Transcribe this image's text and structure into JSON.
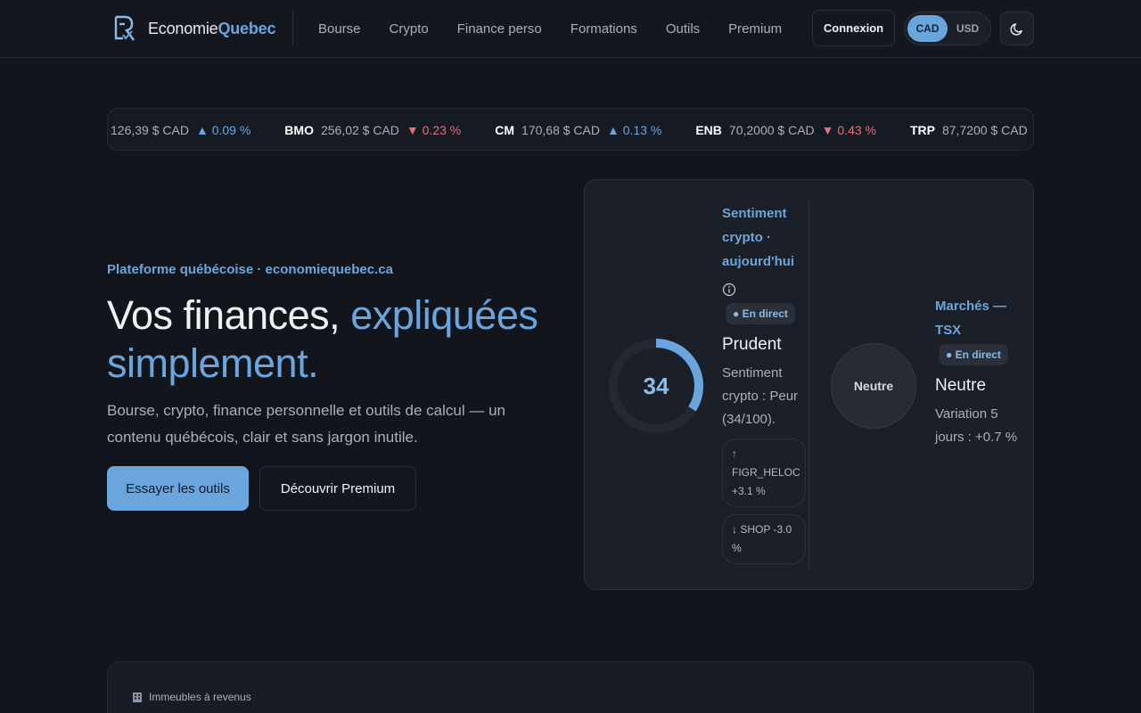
{
  "header": {
    "logo_text_plain": "Economie",
    "logo_text_accent": "Quebec",
    "nav": [
      "Bourse",
      "Crypto",
      "Finance perso",
      "Formations",
      "Outils",
      "Premium"
    ],
    "login_label": "Connexion",
    "currency_options": [
      "CAD",
      "USD"
    ],
    "currency_selected": "CAD",
    "theme_icon": "moon-icon"
  },
  "ticker": [
    {
      "symbol": "",
      "price": "126,39 $ CAD",
      "direction": "up",
      "change": "0.09 %"
    },
    {
      "symbol": "BMO",
      "price": "256,02 $ CAD",
      "direction": "down",
      "change": "0.23 %"
    },
    {
      "symbol": "CM",
      "price": "170,68 $ CAD",
      "direction": "up",
      "change": "0.13 %"
    },
    {
      "symbol": "ENB",
      "price": "70,2000 $ CAD",
      "direction": "down",
      "change": "0.43 %"
    },
    {
      "symbol": "TRP",
      "price": "87,7200 $ CAD",
      "direction": "",
      "change": ""
    }
  ],
  "hero": {
    "tag": "Plateforme québécoise · economiequebec.ca",
    "title_plain": "Vos finances, ",
    "title_accent": "expliquées simplement.",
    "subtitle": "Bourse, crypto, finance personnelle et outils de calcul — un contenu québécois, clair et sans jargon inutile.",
    "primary_button": "Essayer les outils",
    "secondary_button": "Découvrir Premium"
  },
  "sentiment": {
    "gauge_value": "34",
    "gauge_fraction": 0.34,
    "crypto_title": "Sentiment crypto · aujourd'hui",
    "live_label": "● En direct",
    "crypto_state": "Prudent",
    "crypto_desc": "Sentiment crypto : Peur (34/100).",
    "movers": [
      "↑ FIGR_HELOC +3.1 %",
      "↓ SHOP -3.0 %"
    ],
    "market_circle_label": "Neutre",
    "market_title": "Marchés — TSX",
    "market_live_label": "● En direct",
    "market_state": "Neutre",
    "market_desc": "Variation 5 jours : +0.7 %"
  },
  "bottom": {
    "label": "Immeubles à revenus",
    "icon": "building-icon"
  },
  "colors": {
    "accent": "#6aa6dd",
    "down": "#e0707a",
    "background": "#12151c"
  }
}
